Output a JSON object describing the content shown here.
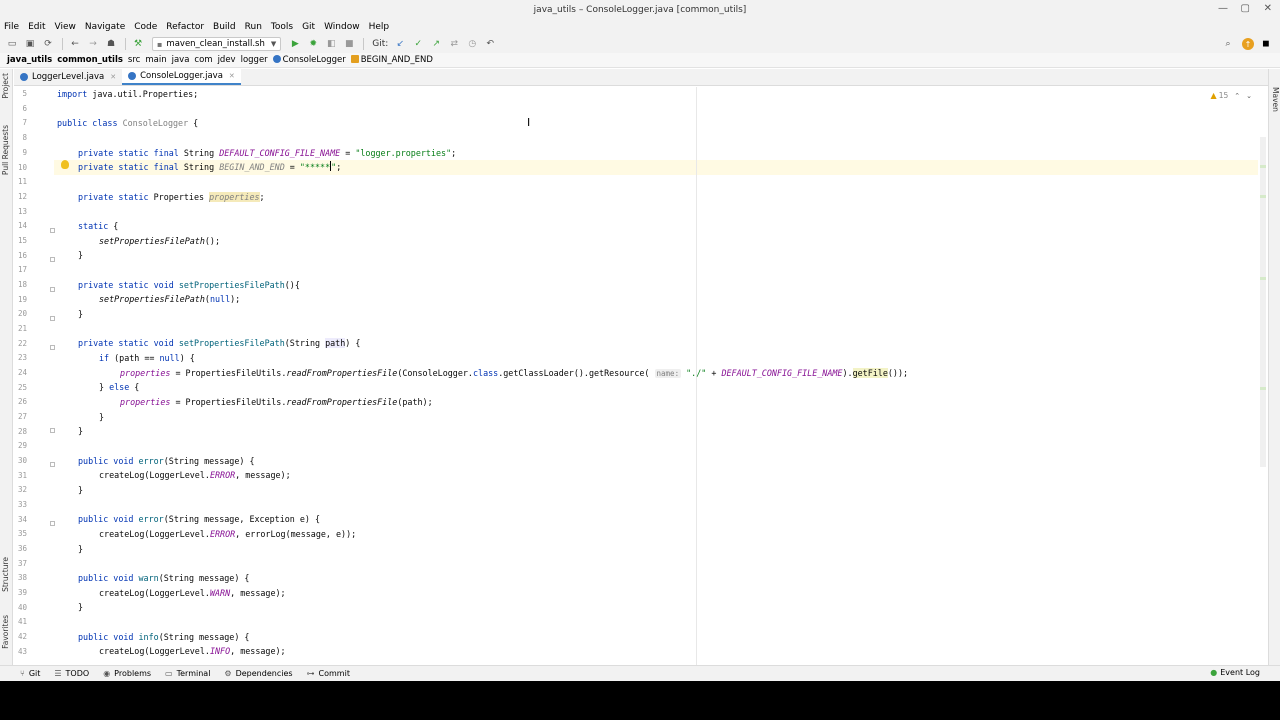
{
  "window": {
    "title": "java_utils – ConsoleLogger.java [common_utils]"
  },
  "menu": [
    "File",
    "Edit",
    "View",
    "Navigate",
    "Code",
    "Refactor",
    "Build",
    "Run",
    "Tools",
    "Git",
    "Window",
    "Help"
  ],
  "toolbar": {
    "run_config": "maven_clean_install.sh",
    "git_label": "Git:"
  },
  "breadcrumb": [
    "java_utils",
    "common_utils",
    "src",
    "main",
    "java",
    "com",
    "jdev",
    "logger",
    "ConsoleLogger",
    "BEGIN_AND_END"
  ],
  "tabs": [
    {
      "label": "LoggerLevel.java",
      "icon": "enum-icon",
      "color": "#3574c4"
    },
    {
      "label": "ConsoleLogger.java",
      "icon": "class-icon",
      "color": "#3574c4",
      "active": true
    }
  ],
  "left_tools": [
    "Project",
    "Pull Requests",
    "Structure",
    "Favorites"
  ],
  "right_tools": [
    "Maven"
  ],
  "inspection": {
    "warnings": "15"
  },
  "line_numbers": [
    "5",
    "6",
    "7",
    "8",
    "9",
    "10",
    "11",
    "12",
    "13",
    "14",
    "15",
    "16",
    "17",
    "18",
    "19",
    "20",
    "21",
    "22",
    "23",
    "24",
    "25",
    "26",
    "27",
    "28",
    "29",
    "30",
    "31",
    "32",
    "33",
    "34",
    "35",
    "36",
    "37",
    "38",
    "39",
    "40",
    "41",
    "42",
    "43"
  ],
  "code": {
    "l5": {
      "kw": "import",
      "rest": " java.util.Properties;"
    },
    "l7": {
      "kw1": "public class",
      "name": "ConsoleLogger",
      "rest": " {"
    },
    "l9": {
      "kw": "private static final",
      "type": " String ",
      "const": "DEFAULT_CONFIG_FILE_NAME",
      "eq": " = ",
      "str": "\"logger.properties\"",
      "end": ";"
    },
    "l10": {
      "kw": "private static final",
      "type": " String ",
      "const": "BEGIN_AND_END",
      "eq": " = ",
      "str": "\"*****",
      "strend": "\"",
      "end": ";"
    },
    "l12": {
      "kw": "private static",
      "type": " Properties ",
      "field": "properties",
      "end": ";"
    },
    "l14": {
      "kw": "static",
      "rest": " {"
    },
    "l15": {
      "call": "setPropertiesFilePath",
      "rest": "();"
    },
    "l16": {
      "rest": "}"
    },
    "l18": {
      "kw": "private static void",
      "name": "setPropertiesFilePath",
      "rest": "(){"
    },
    "l19": {
      "call": "setPropertiesFilePath",
      "pre": "(",
      "kw": "null",
      "rest": ");"
    },
    "l20": {
      "rest": "}"
    },
    "l22": {
      "kw": "private static void",
      "name": "setPropertiesFilePath",
      "pre": "(String ",
      "param": "path",
      "rest": ") {"
    },
    "l23": {
      "kw": "if",
      "pre": " (path == ",
      "kw2": "null",
      "rest": ") {"
    },
    "l24": {
      "field": "properties",
      "mid": " = PropertiesFileUtils.",
      "call": "readFromPropertiesFile",
      "mid2": "(ConsoleLogger.",
      "kw": "class",
      "mid3": ".getClassLoader().getResource(",
      "hint": "name:",
      "str": "\"./\"",
      "plus": " + ",
      "const": "DEFAULT_CONFIG_FILE_NAME",
      "tail1": ").",
      "m": "getFile",
      "tail2": "());"
    },
    "l25": {
      "pre": "} ",
      "kw": "else",
      "rest": " {"
    },
    "l26": {
      "field": "properties",
      "mid": " = PropertiesFileUtils.",
      "call": "readFromPropertiesFile",
      "rest": "(path);"
    },
    "l27": {
      "rest": "}"
    },
    "l28": {
      "rest": "}"
    },
    "l30": {
      "kw": "public void",
      "name": "error",
      "rest": "(String message) {"
    },
    "l31": {
      "pre": "createLog(LoggerLevel.",
      "const": "ERROR",
      "rest": ", message);"
    },
    "l32": {
      "rest": "}"
    },
    "l34": {
      "kw": "public void",
      "name": "error",
      "rest": "(String message, Exception e) {"
    },
    "l35": {
      "pre": "createLog(LoggerLevel.",
      "const": "ERROR",
      "rest": ", errorLog(message, e));"
    },
    "l36": {
      "rest": "}"
    },
    "l38": {
      "kw": "public void",
      "name": "warn",
      "rest": "(String message) {"
    },
    "l39": {
      "pre": "createLog(LoggerLevel.",
      "const": "WARN",
      "rest": ", message);"
    },
    "l40": {
      "rest": "}"
    },
    "l42": {
      "kw": "public void",
      "name": "info",
      "rest": "(String message) {"
    },
    "l43": {
      "pre": "createLog(LoggerLevel.",
      "const": "INFO",
      "rest": ", message);"
    }
  },
  "bottom_tools": [
    {
      "label": "Git",
      "icon": "git-branch-icon"
    },
    {
      "label": "TODO",
      "icon": "list-icon"
    },
    {
      "label": "Problems",
      "icon": "problems-icon"
    },
    {
      "label": "Terminal",
      "icon": "terminal-icon"
    },
    {
      "label": "Dependencies",
      "icon": "dependencies-icon"
    },
    {
      "label": "Commit",
      "icon": "commit-icon"
    }
  ],
  "event_log": "Event Log",
  "colors": {
    "keyword": "#0033b3",
    "string": "#067d17",
    "constant": "#871094",
    "method": "#00627a",
    "caret_line": "#fffae3"
  }
}
